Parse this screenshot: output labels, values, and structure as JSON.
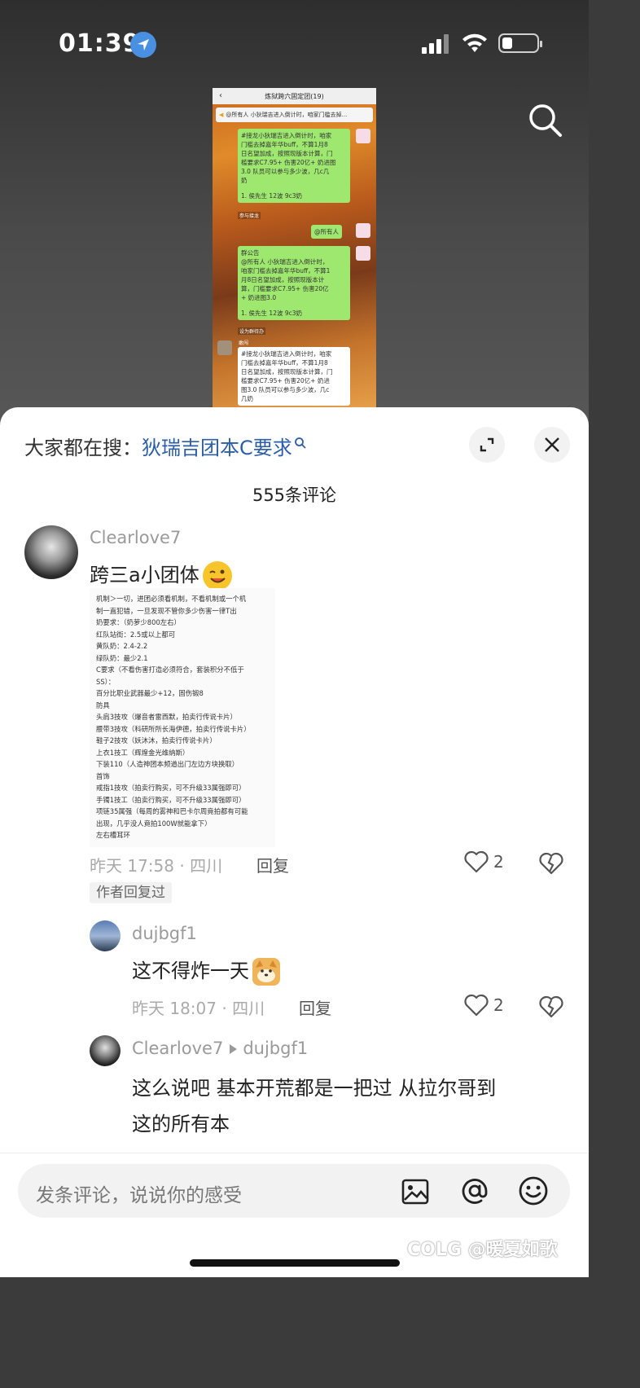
{
  "status": {
    "time": "01:39"
  },
  "screenshot": {
    "title": "炼狱跨六固定团(19)",
    "notice": "@所有人 小狄瑞吉进入倒计时，咱家门槛去掉...",
    "msg1": [
      "#接龙小狄瑞吉进入倒计时，咱家",
      "门槛去掉嘉年华buff，不算1月8",
      "日名望加成，按照现版本计算，门",
      "槛要求C7.95+ 伤害20亿+ 奶进图",
      "3.0 队员可以参与多少波，几c几",
      "奶",
      "",
      "1. 侯先生 12波 9c3奶"
    ],
    "tag1": "参与接龙",
    "msg2": "@所有人",
    "msg3": [
      "群公告",
      "@所有人 小狄瑞吉进入倒计时，",
      "咱家门槛去掉嘉年华buff，不算1",
      "月8日名望加成，按照现版本计",
      "算，门槛要求C7.95+ 伤害20亿",
      "+ 奶进图3.0",
      "",
      "1. 侯先生 12波 9c3奶"
    ],
    "tag2": "设为群待办",
    "sender": "敢闯",
    "msg4": [
      "#接龙小狄瑞吉进入倒计时，咱家",
      "门槛去掉嘉年华buff，不算1月8",
      "日名望加成，按照现版本计算，门",
      "槛要求C7.95+ 伤害20亿+ 奶进",
      "图3.0 队员可以参与多少波，几c",
      "几奶"
    ]
  },
  "sheet": {
    "hot_prefix": "大家都在搜：",
    "hot_query": "狄瑞吉团本C要求",
    "comment_count": "555条评论"
  },
  "comments": [
    {
      "user": "Clearlove7",
      "text": "跨三a小团体",
      "meta": "昨天 17:58 · 四川",
      "reply": "回复",
      "likes": "2",
      "badge": "作者回复过",
      "attachment": [
        "机制＞一切，进团必须看机制，不看机制或一个机",
        "制一直犯错，一旦发现不管你多少伤害一律T出",
        "奶要求：（奶萝少800左右）",
        "红队站街：2.5或以上都可",
        "黄队奶：2.4-2.2",
        "绿队奶：最少2.1",
        "C要求（不看伤害打造必须符合，套装积分不低于",
        "SS）：",
        "百分比职业武器最少+12，固伤锻8",
        "防具",
        "头肩3技攻（爆音者雷西默，拍卖行传说卡片）",
        "腰带3技攻（科研所所长海伊德，拍卖行传说卡片）",
        "鞋子2技攻（妖沐沐，拍卖行传说卡片）",
        "上衣1技工（辉煌金光维纳斯）",
        "下装110（人造神团本频道出门左边方块换取）",
        "首饰",
        "戒指1技攻（拍卖行购买，可不升级33属强即可）",
        "手镯1技工（拍卖行购买，可不升级33属强即可）",
        "项链35属强（每周的雾神和巴卡尔周竟拍都有可能",
        "出现，几乎没人竟拍100W就能拿下）",
        "左右槽耳环"
      ]
    },
    {
      "user": "dujbgf1",
      "text": "这不得炸一天",
      "meta": "昨天 18:07 · 四川",
      "reply": "回复",
      "likes": "2"
    },
    {
      "user": "Clearlove7",
      "reply_to": "dujbgf1",
      "text_line1": "这么说吧  基本开荒都是一把过  从拉尔哥到",
      "text_line2": "这的所有本"
    }
  ],
  "input": {
    "placeholder": "发条评论，说说你的感受",
    "watermark": "COLG @暖夏如歌"
  }
}
